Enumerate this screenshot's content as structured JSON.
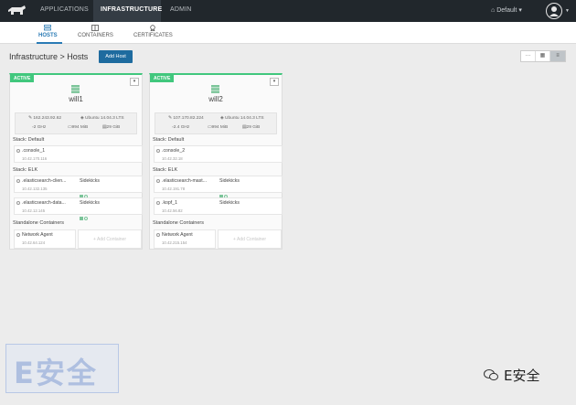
{
  "topnav": {
    "items": [
      "APPLICATIONS",
      "INFRASTRUCTURE",
      "ADMIN"
    ],
    "environment": "Default"
  },
  "subnav": {
    "tabs": [
      "HOSTS",
      "CONTAINERS",
      "CERTIFICATES"
    ]
  },
  "page": {
    "breadcrumb": "Infrastructure > Hosts",
    "add_host": "Add Host"
  },
  "hosts": [
    {
      "state": "ACTIVE",
      "name": "will1",
      "ip": "162.243.92.62",
      "os": "Ubuntu 14.04.3 LTS",
      "cpu": "2 GHz",
      "mem": "994 MiB",
      "disk": "29 GiB",
      "stack_default_label": "Stack: Default",
      "stack_default": [
        {
          "name": ".console_1",
          "ip": "10.42.170.116"
        }
      ],
      "stack_elk_label": "Stack: ELK",
      "stack_elk": [
        {
          "name": ".elasticsearch-clien...",
          "ip": "10.42.132.135",
          "sidekicks": "Sidekicks"
        },
        {
          "name": ".elasticsearch-data...",
          "ip": "10.42.12.145",
          "sidekicks": "Sidekicks"
        }
      ],
      "standalone_label": "Standalone Containers",
      "standalone": [
        {
          "name": "Network Agent",
          "ip": "10.42.64.124"
        }
      ],
      "add_container": "Add Container"
    },
    {
      "state": "ACTIVE",
      "name": "will2",
      "ip": "107.170.82.224",
      "os": "Ubuntu 14.04.3 LTS",
      "cpu": "2.4 GHz",
      "mem": "994 MiB",
      "disk": "29 GiB",
      "stack_default_label": "Stack: Default",
      "stack_default": [
        {
          "name": ".console_2",
          "ip": "10.42.32.18"
        }
      ],
      "stack_elk_label": "Stack: ELK",
      "stack_elk": [
        {
          "name": ".elasticsearch-mast...",
          "ip": "10.42.191.78",
          "sidekicks": "Sidekicks"
        },
        {
          "name": ".kopf_1",
          "ip": "10.42.56.82",
          "sidekicks": "Sidekicks"
        }
      ],
      "standalone_label": "Standalone Containers",
      "standalone": [
        {
          "name": "Network Agent",
          "ip": "10.42.215.154"
        }
      ],
      "add_container": "Add Container"
    }
  ],
  "watermark": {
    "left": "E安全",
    "right": "E安全"
  },
  "colors": {
    "nav_bg": "#21272c",
    "accent": "#2a7bb5",
    "active_green": "#41c77d",
    "button_blue": "#1e6b9f"
  }
}
